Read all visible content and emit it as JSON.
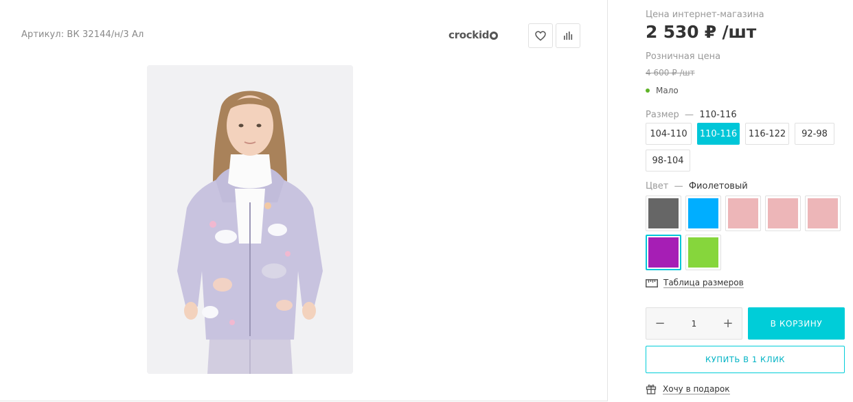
{
  "product": {
    "sku": "Артикул: ВК 32144/н/3 Ал",
    "brand": "crockid"
  },
  "icons": {
    "favorite": "heart-icon",
    "compare": "bar-chart-icon",
    "size_table": "ruler-icon",
    "gift": "gift-icon",
    "stock": "dot-icon"
  },
  "pricing": {
    "online_label": "Цена интернет-магазина",
    "online_price": "2 530 ₽ /шт",
    "retail_label": "Розничная цена",
    "retail_price": "4 600 ₽ /шт"
  },
  "stock": {
    "text": "Мало",
    "color": "#5fb328"
  },
  "size": {
    "label": "Размер",
    "dash": "—",
    "selected": "110-116",
    "options": [
      "104-110",
      "110-116",
      "116-122",
      "92-98",
      "98-104"
    ]
  },
  "color": {
    "label": "Цвет",
    "dash": "—",
    "selected": "Фиолетовый",
    "swatches": [
      "#666666",
      "#00aeff",
      "#edb6b8",
      "#edb6b8",
      "#edb6b8",
      "#a61eb5",
      "#86d63c"
    ]
  },
  "links": {
    "size_table": "Таблица размеров",
    "gift": "Хочу в подарок"
  },
  "quantity": {
    "minus": "−",
    "value": "1",
    "plus": "+"
  },
  "buttons": {
    "cart": "В КОРЗИНУ",
    "one_click": "КУПИТЬ В 1 КЛИК"
  },
  "theme": {
    "accent": "#00cdd8"
  }
}
